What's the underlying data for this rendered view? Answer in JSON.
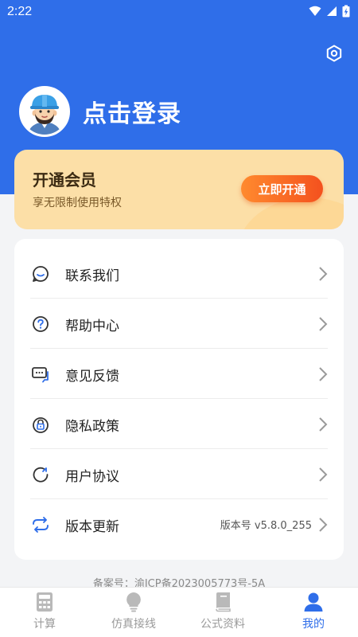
{
  "status_bar": {
    "time": "2:22"
  },
  "header": {
    "login_label": "点击登录",
    "settings_icon": "gear-icon"
  },
  "vip": {
    "title": "开通会员",
    "subtitle": "享无限制使用特权",
    "button_label": "立即开通"
  },
  "menu": {
    "items": [
      {
        "label": "联系我们",
        "icon": "chat-bubble-icon",
        "extra": ""
      },
      {
        "label": "帮助中心",
        "icon": "help-circle-icon",
        "extra": ""
      },
      {
        "label": "意见反馈",
        "icon": "feedback-icon",
        "extra": ""
      },
      {
        "label": "隐私政策",
        "icon": "privacy-lock-icon",
        "extra": ""
      },
      {
        "label": "用户协议",
        "icon": "agreement-icon",
        "extra": ""
      },
      {
        "label": "版本更新",
        "icon": "refresh-icon",
        "extra": "版本号 v5.8.0_255"
      }
    ]
  },
  "icp": "备案号：渝ICP备2023005773号-5A",
  "tabbar": {
    "tabs": [
      {
        "label": "计算",
        "icon": "calculator-icon",
        "active": false
      },
      {
        "label": "仿真接线",
        "icon": "lightbulb-icon",
        "active": false
      },
      {
        "label": "公式资料",
        "icon": "book-icon",
        "active": false
      },
      {
        "label": "我的",
        "icon": "user-icon",
        "active": true
      }
    ]
  },
  "colors": {
    "primary": "#2f6ee9",
    "vip_bg": "#fcdfa7",
    "vip_button": "#f4511e",
    "inactive_tab": "#9a9a9a"
  }
}
